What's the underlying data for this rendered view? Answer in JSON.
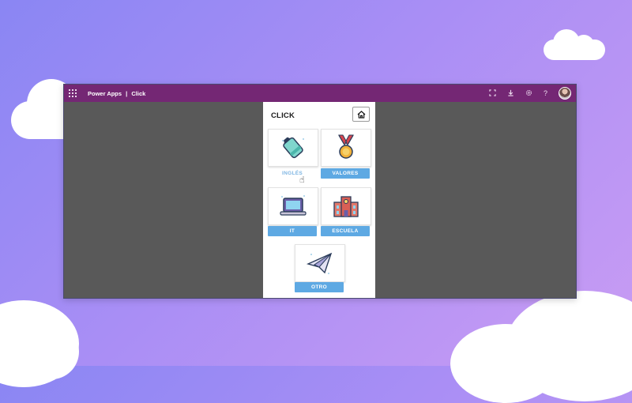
{
  "topbar": {
    "app_name": "Power Apps",
    "separator": "|",
    "app_title": "Click",
    "icons": [
      "fit-screen-icon",
      "download-icon",
      "settings-icon",
      "help-icon",
      "avatar"
    ]
  },
  "canvas": {
    "title": "CLICK",
    "home_icon": "home-icon",
    "tiles": [
      {
        "label": "INGLÉS",
        "icon": "marker-icon"
      },
      {
        "label": "VALORES",
        "icon": "medal-icon"
      },
      {
        "label": "IT",
        "icon": "laptop-icon"
      },
      {
        "label": "ESCUELA",
        "icon": "school-icon"
      },
      {
        "label": "OTRO",
        "icon": "paper-plane-icon"
      }
    ]
  },
  "colors": {
    "topbar": "#742774",
    "label_button": "#5ea9e3",
    "workspace": "#595959",
    "background_start": "#8a86f3",
    "background_end": "#c99cf3"
  }
}
